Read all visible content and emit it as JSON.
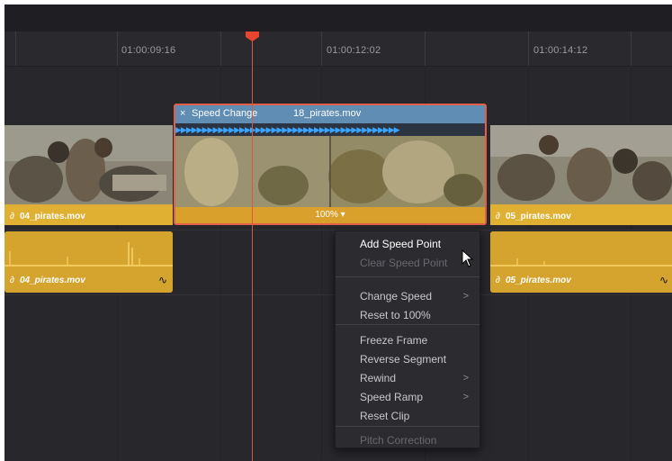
{
  "ruler": {
    "timecodes": [
      "01:00:09:16",
      "01:00:12:02",
      "01:00:14:12"
    ]
  },
  "selected_clip": {
    "close_glyph": "×",
    "effect_label": "Speed Change",
    "filename": "18_pirates.mov",
    "speed": "100% ▾",
    "frame_glyph": "▶"
  },
  "video_clips": {
    "left": {
      "name": "04_pirates.mov",
      "link_glyph": "∂"
    },
    "right": {
      "name": "05_pirates.mov",
      "link_glyph": "∂"
    }
  },
  "audio_clips": {
    "left": {
      "name": "04_pirates.mov",
      "link_glyph": "∂",
      "curve_glyph": "∿"
    },
    "right": {
      "name": "05_pirates.mov",
      "link_glyph": "∂",
      "curve_glyph": "∿"
    }
  },
  "context_menu": {
    "items": [
      {
        "label": "Add Speed Point",
        "state": "active",
        "submenu": ""
      },
      {
        "label": "Clear Speed Point",
        "state": "disabled",
        "submenu": ""
      },
      {
        "label": "Change Speed",
        "state": "normal",
        "submenu": ">"
      },
      {
        "label": "Reset to 100%",
        "state": "normal",
        "submenu": ""
      },
      {
        "label": "Freeze Frame",
        "state": "normal",
        "submenu": ""
      },
      {
        "label": "Reverse Segment",
        "state": "normal",
        "submenu": ""
      },
      {
        "label": "Rewind",
        "state": "normal",
        "submenu": ">"
      },
      {
        "label": "Speed Ramp",
        "state": "normal",
        "submenu": ">"
      },
      {
        "label": "Reset Clip",
        "state": "normal",
        "submenu": ""
      },
      {
        "label": "Pitch Correction",
        "state": "disabled",
        "submenu": ""
      }
    ]
  },
  "colors": {
    "clip_yellow": "#e0b032",
    "selection_red": "#e35f4a",
    "header_blue": "#5f8db3",
    "playhead": "#e8452e",
    "speed_arrows": "#3aa4ff"
  }
}
